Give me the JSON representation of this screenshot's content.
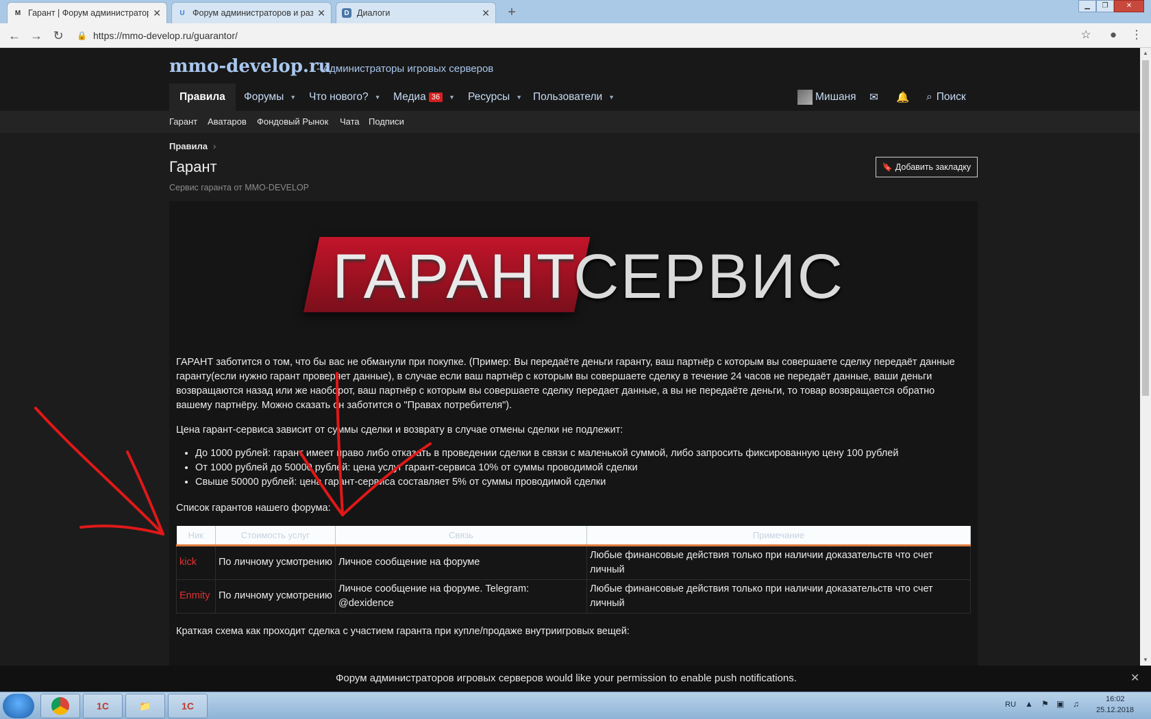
{
  "browser": {
    "tabs": [
      {
        "icon": "M",
        "title": "Гарант | Форум администратор",
        "active": true
      },
      {
        "icon": "U",
        "title": "Форум администраторов и раз",
        "active": false
      },
      {
        "icon": "D",
        "title": "Диалоги",
        "active": false
      }
    ],
    "url": "https://mmo-develop.ru/guarantor/"
  },
  "site": {
    "logo": "mmo-develop.ru",
    "tagline": "- Администраторы игровых серверов",
    "nav": [
      {
        "label": "Правила"
      },
      {
        "label": "Форумы"
      },
      {
        "label": "Что нового?"
      },
      {
        "label": "Медиа",
        "badge": "36"
      },
      {
        "label": "Ресурсы"
      },
      {
        "label": "Пользователи"
      }
    ],
    "user": {
      "name": "Мишаня"
    },
    "search_label": "Поиск",
    "subnav": [
      "Гарант",
      "Аватаров",
      "Фондовый Рынок",
      "Чата",
      "Подписи"
    ]
  },
  "page": {
    "breadcrumb": "Правила",
    "title": "Гарант",
    "description": "Сервис гаранта от MMO-DEVELOP",
    "bookmark_label": "Добавить закладку",
    "banner": {
      "word1": "ГАРАНТ",
      "word2": "СЕРВИС"
    },
    "intro": "ГАРАНТ заботится о том, что бы вас не обманули при покупке. (Пример: Вы передаёте деньги гаранту, ваш партнёр с которым вы совершаете сделку передаёт данные гаранту(если нужно гарант проверяет данные), в случае если ваш партнёр с которым вы совершаете сделку в течение 24 часов не передаёт данные, ваши деньги возвращаются назад или же наоборот, ваш партнёр с которым вы совершаете сделку передает данные, а вы не передаёте деньги, то товар возвращается обратно вашему партнёру. Можно сказать он заботится о \"Правах потребителя\").",
    "price_text": "Цена гарант-сервиса зависит от суммы сделки и возврату в случае отмены сделки не подлежит:",
    "bullets": [
      "До 1000 рублей: гарант имеет право либо отказать в проведении сделки в связи с маленькой суммой, либо запросить фиксированную цену 100 рублей",
      "От 1000 рублей до 50000 рублей: цена услуг гарант-сервиса 10% от суммы проводимой сделки",
      "Свыше 50000 рублей: цена гарант-сервиса составляет 5% от суммы проводимой сделки"
    ],
    "list_title": "Список гарантов нашего форума:",
    "table": {
      "headers": [
        "Ник",
        "Стоимость услуг",
        "Связь",
        "Примечание"
      ],
      "rows": [
        [
          "kick",
          "По личному усмотрению",
          "Личное сообщение на форуме",
          "Любые финансовые действия только при наличии доказательств что счет личный"
        ],
        [
          "Enmity",
          "По личному усмотрению",
          "Личное сообщение на форуме. Telegram: @dexidence",
          "Любые финансовые действия только при наличии доказательств что счет личный"
        ]
      ]
    },
    "scheme_text": "Краткая схема как проходит сделка с участием гаранта при купле/продаже внутриигровых вещей:"
  },
  "push_notification": "Форум администраторов игровых серверов would like your permission to enable push notifications.",
  "taskbar": {
    "apps": [
      "chrome",
      "1c",
      "explorer",
      "1c"
    ],
    "lang": "RU",
    "time": "16:02",
    "date": "25.12.2018"
  }
}
